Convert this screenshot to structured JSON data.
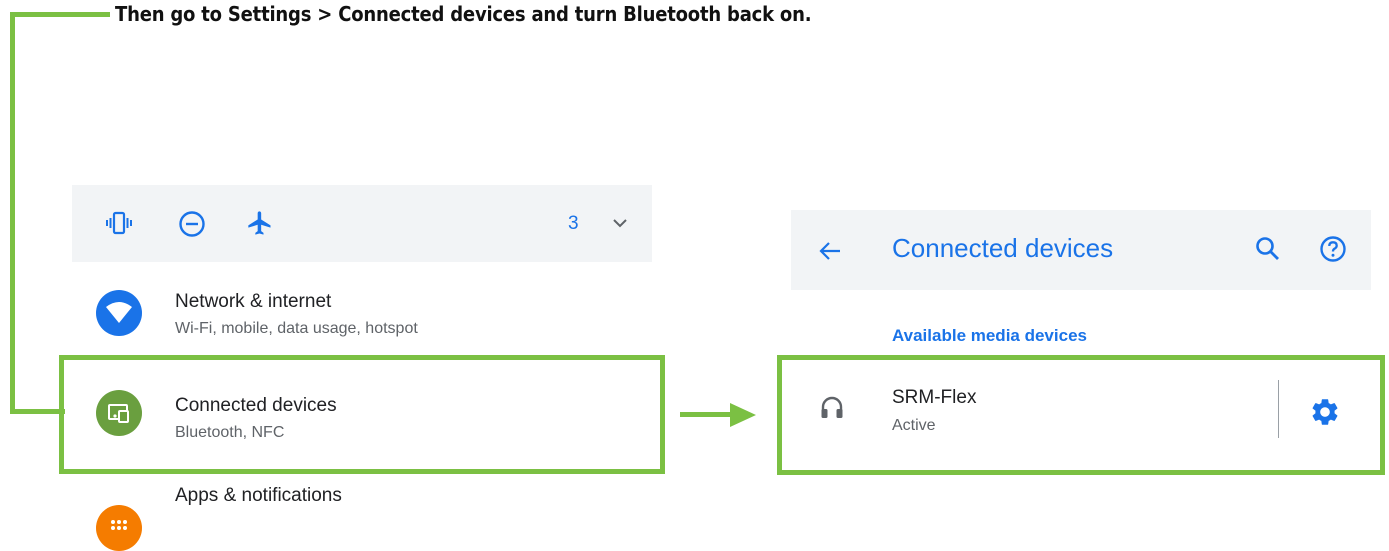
{
  "instruction": "Then go to Settings > Connected devices and turn Bluetooth back on.",
  "quick_settings": {
    "icons": [
      "vibrate-icon",
      "do-not-disturb-icon",
      "airplane-icon"
    ],
    "notification_count": "3"
  },
  "settings_list": {
    "items": [
      {
        "title": "Network & internet",
        "subtitle": "Wi-Fi, mobile, data usage, hotspot",
        "icon": "wifi-icon",
        "color": "#1a73e8"
      },
      {
        "title": "Connected devices",
        "subtitle": "Bluetooth, NFC",
        "icon": "connected-devices-icon",
        "color": "#6a9f3f"
      },
      {
        "title": "Apps & notifications",
        "subtitle": "",
        "icon": "apps-icon",
        "color": "#f57c00"
      }
    ]
  },
  "connected_devices": {
    "title": "Connected devices",
    "section_label": "Available media devices",
    "device": {
      "name": "SRM-Flex",
      "status": "Active",
      "icon": "headphones-icon"
    }
  },
  "colors": {
    "highlight": "#7bc043",
    "accent": "#1a73e8"
  }
}
